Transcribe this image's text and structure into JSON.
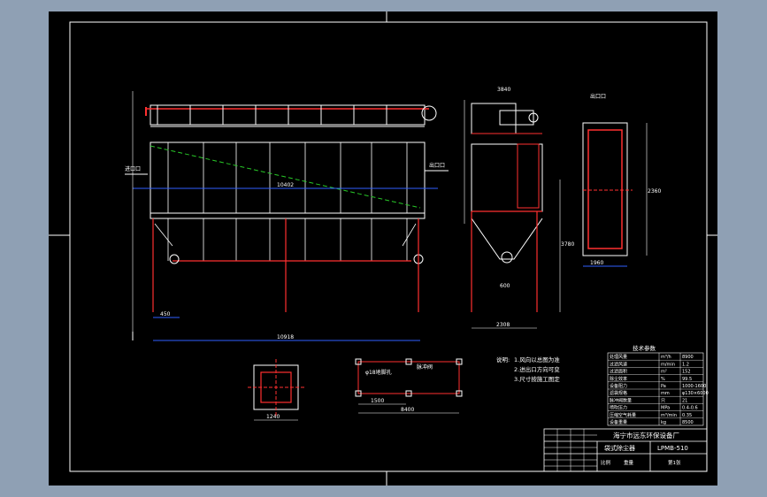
{
  "labels": {
    "outlet_top": "出口口",
    "inlet_left": "进口口",
    "outlet_right": "出口口",
    "dim_span_inner": "10402",
    "dim_total": "10918",
    "dim_a": "450",
    "dim_b": "3840",
    "dim_c": "8400",
    "dim_height": "3780",
    "side_width": "2308",
    "plan_width": "1960",
    "plan_depth": "2360",
    "small_dim": "600",
    "flange_dim": "1240",
    "flange_pitch": "1500",
    "valve_note": "脉冲阀",
    "anchor_note": "φ18地脚孔"
  },
  "notes": {
    "title": "说明:",
    "line1": "1.风向以总图为准",
    "line2": "2.进出口方向可变",
    "line3": "3.尺寸按施工图定"
  },
  "tech_table": {
    "title": "技术参数",
    "rows": [
      [
        "处理风量",
        "m³/h",
        "8900"
      ],
      [
        "过滤风速",
        "m/min",
        "1.2"
      ],
      [
        "过滤面积",
        "m²",
        "152"
      ],
      [
        "除尘效率",
        "%",
        "99.5"
      ],
      [
        "设备阻力",
        "Pa",
        "1000-1600"
      ],
      [
        "滤袋规格",
        "mm",
        "φ130×6000"
      ],
      [
        "脉冲阀数量",
        "只",
        "21"
      ],
      [
        "喷吹压力",
        "MPa",
        "0.4-0.6"
      ],
      [
        "压缩空气耗量",
        "m³/min",
        "0.35"
      ],
      [
        "设备重量",
        "kg",
        "8500"
      ]
    ]
  },
  "title_block": {
    "company": "海宁市远东环保设备厂",
    "drawing_name": "袋式除尘器",
    "drawing_no": "LPMB-510",
    "scale_label": "比例",
    "weight_label": "重量",
    "sheet_label": "第1张"
  }
}
